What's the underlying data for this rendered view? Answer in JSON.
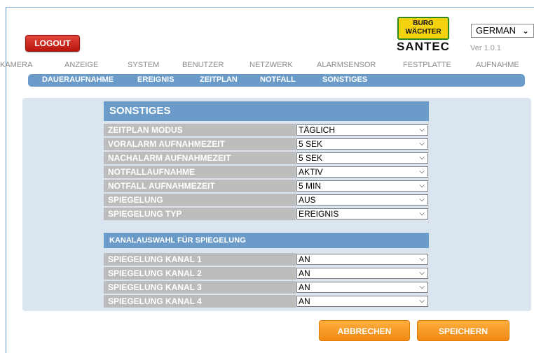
{
  "header": {
    "logout_label": "LOGOUT",
    "logo": {
      "top": "BURG",
      "middle": "WÄCHTER",
      "bottom": "SANTEC"
    },
    "language": {
      "selected": "GERMAN",
      "icon": "chevron-down-icon"
    },
    "version": "Ver 1.0.1"
  },
  "mainnav": [
    "KAMERA",
    "ANZEIGE",
    "SYSTEM",
    "BENUTZER",
    "NETZWERK",
    "ALARMSENSOR",
    "FESTPLATTE",
    "AUFNAHME"
  ],
  "subnav": [
    "DAUERAUFNAHME",
    "EREIGNIS",
    "ZEITPLAN",
    "NOTFALL",
    "SONSTIGES"
  ],
  "section1": {
    "title": "SONSTIGES",
    "rows": [
      {
        "label": "ZEITPLAN MODUS",
        "value": "TÄGLICH"
      },
      {
        "label": "VORALARM AUFNAHMEZEIT",
        "value": "5 SEK"
      },
      {
        "label": "NACHALARM AUFNAHMEZEIT",
        "value": "5 SEK"
      },
      {
        "label": "NOTFALLAUFNAHME",
        "value": "AKTIV"
      },
      {
        "label": "NOTFALL AUFNAHMEZEIT",
        "value": "5 MIN"
      },
      {
        "label": "SPIEGELUNG",
        "value": "AUS"
      },
      {
        "label": "SPIEGELUNG TYP",
        "value": "EREIGNIS"
      }
    ]
  },
  "section2": {
    "title": "KANALAUSWAHL FÜR SPIEGELUNG",
    "rows": [
      {
        "label": "SPIEGELUNG KANAL 1",
        "value": "AN"
      },
      {
        "label": "SPIEGELUNG KANAL 2",
        "value": "AN"
      },
      {
        "label": "SPIEGELUNG KANAL 3",
        "value": "AN"
      },
      {
        "label": "SPIEGELUNG KANAL 4",
        "value": "AN"
      }
    ]
  },
  "buttons": {
    "cancel": "ABBRECHEN",
    "save": "SPEICHERN"
  },
  "colors": {
    "accent": "#6b9cc9",
    "orange": "#f59a23",
    "logout": "#cf2a1e",
    "logo_yellow": "#f5d20e",
    "logo_green": "#2e8a1c"
  }
}
